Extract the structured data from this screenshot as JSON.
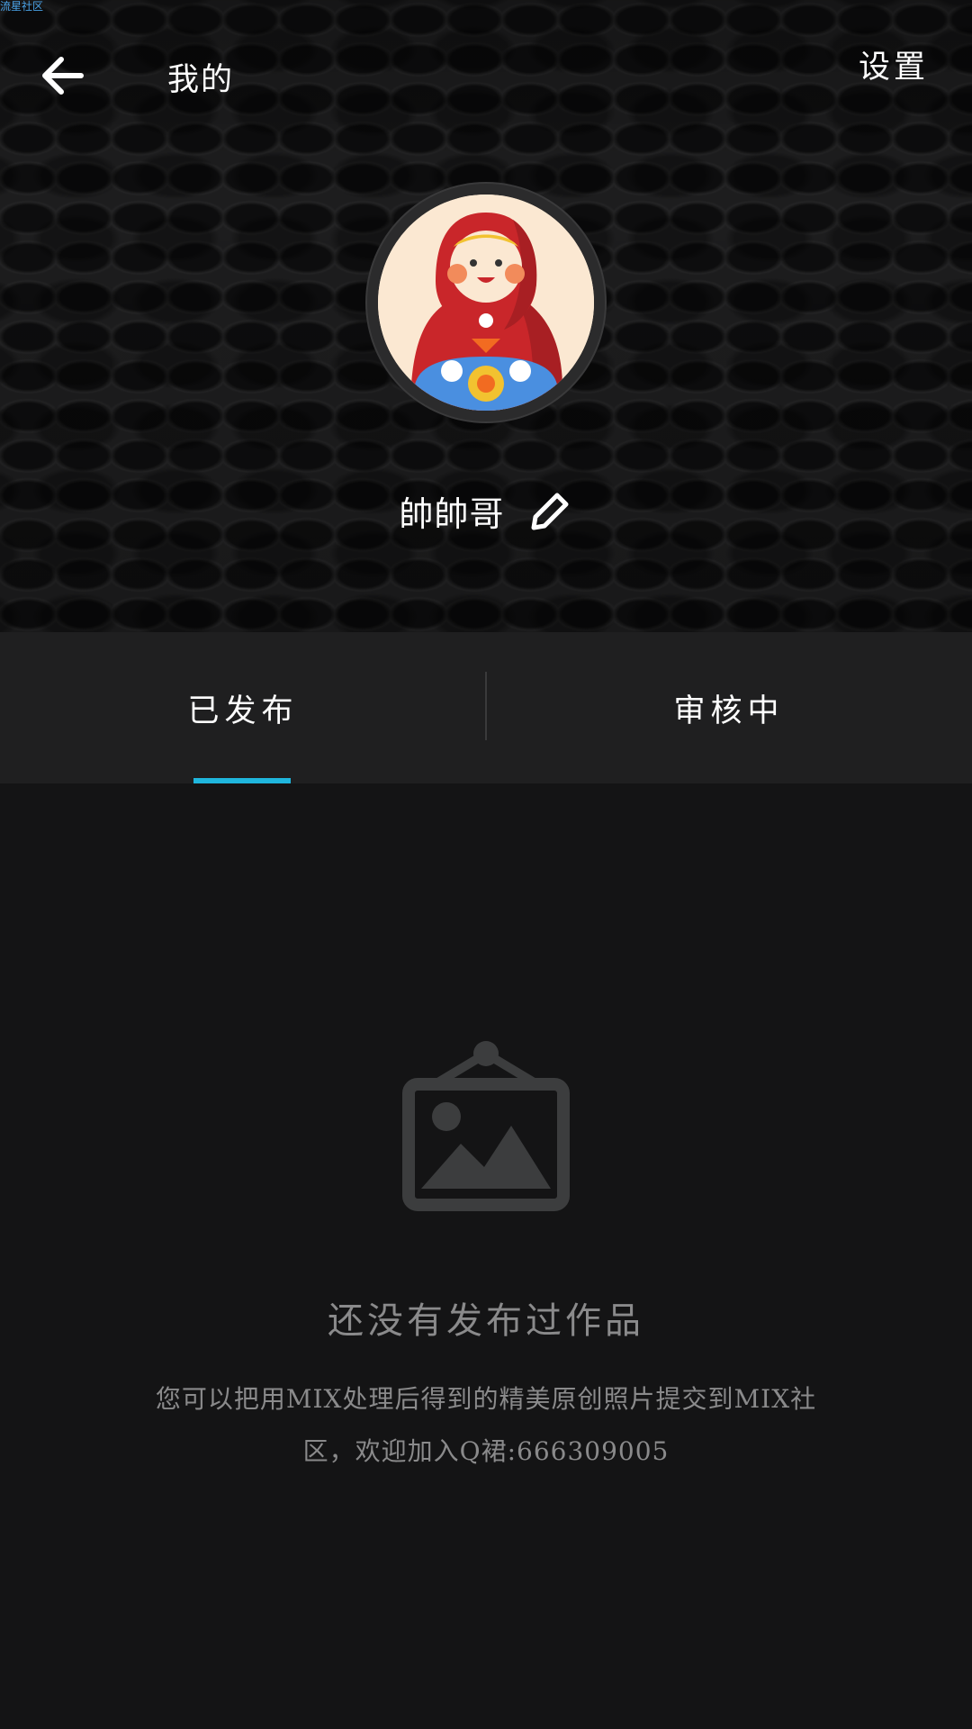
{
  "watermark": "流星社区",
  "header": {
    "title": "我的",
    "settings_label": "设置",
    "username": "帥帥哥"
  },
  "tabs": [
    {
      "label": "已发布",
      "active": true
    },
    {
      "label": "审核中",
      "active": false
    }
  ],
  "empty_state": {
    "title": "还没有发布过作品",
    "description": "您可以把用MIX处理后得到的精美原创照片提交到MIX社区，欢迎加入Q裙:666309005"
  },
  "colors": {
    "accent": "#1fb6dd",
    "background": "#141415",
    "tab_bar": "#1f1f20",
    "muted_text": "#8a8a8b"
  },
  "icons": {
    "back": "arrow-left-icon",
    "edit": "pencil-icon",
    "empty": "picture-frame-icon",
    "avatar": "matryoshka-doll-avatar"
  }
}
